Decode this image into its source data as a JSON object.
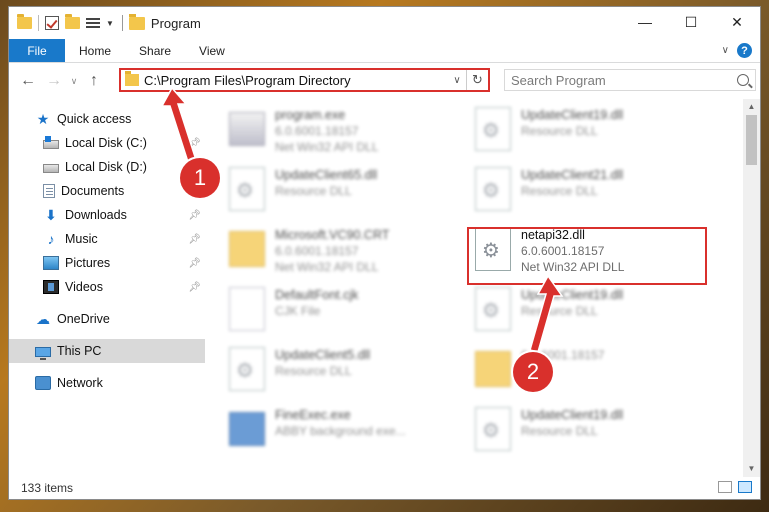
{
  "title_bar": {
    "title": "Program",
    "minimize": "—",
    "maximize": "☐",
    "close": "✕"
  },
  "ribbon": {
    "tabs": [
      "File",
      "Home",
      "Share",
      "View"
    ],
    "help": "?"
  },
  "address_bar": {
    "path": "C:\\Program Files\\Program Directory",
    "search_placeholder": "Search Program"
  },
  "sidebar": {
    "quick_access": "Quick access",
    "items": [
      {
        "label": "Local Disk (C:)",
        "icon": "drive-windows-icon",
        "pinned": true
      },
      {
        "label": "Local Disk (D:)",
        "icon": "drive-icon",
        "pinned": false
      },
      {
        "label": "Documents",
        "icon": "documents-icon",
        "pinned": true
      },
      {
        "label": "Downloads",
        "icon": "download-icon",
        "pinned": true
      },
      {
        "label": "Music",
        "icon": "music-icon",
        "pinned": true
      },
      {
        "label": "Pictures",
        "icon": "pictures-icon",
        "pinned": true
      },
      {
        "label": "Videos",
        "icon": "videos-icon",
        "pinned": true
      }
    ],
    "onedrive": "OneDrive",
    "this_pc": "This PC",
    "network": "Network"
  },
  "files": [
    {
      "name": "program.exe",
      "line1": "6.0.6001.18157",
      "line2": "Net Win32 API DLL",
      "icon": "exe"
    },
    {
      "name": "UpdateClient19.dll",
      "line1": "Resource DLL",
      "line2": "",
      "icon": "doc"
    },
    {
      "name": "UpdateClient65.dll",
      "line1": "Resource DLL",
      "line2": "",
      "icon": "doc"
    },
    {
      "name": "UpdateClient21.dll",
      "line1": "Resource DLL",
      "line2": "",
      "icon": "doc"
    },
    {
      "name": "Microsoft.VC90.CRT",
      "line1": "6.0.6001.18157",
      "line2": "Net Win32 API DLL",
      "icon": "folder"
    },
    {
      "name": "netapi32.dll",
      "line1": "6.0.6001.18157",
      "line2": "Net Win32 API DLL",
      "icon": "doc",
      "focus": true
    },
    {
      "name": "DefaultFont.cjk",
      "line1": "CJK File",
      "line2": "",
      "icon": "plain"
    },
    {
      "name": "UpdateClient19.dll",
      "line1": "Resource DLL",
      "line2": "",
      "icon": "doc"
    },
    {
      "name": "UpdateClient5.dll",
      "line1": "Resource DLL",
      "line2": "",
      "icon": "doc"
    },
    {
      "name": "",
      "line1": "6.0.6001.18157",
      "line2": "",
      "icon": "folder"
    },
    {
      "name": "FineExec.exe",
      "line1": "ABBY background exe...",
      "line2": "",
      "icon": "app"
    },
    {
      "name": "UpdateClient19.dll",
      "line1": "Resource DLL",
      "line2": "",
      "icon": "doc"
    }
  ],
  "status": {
    "item_count": "133 items"
  },
  "callouts": [
    "1",
    "2"
  ],
  "colors": {
    "accent": "#1979ca",
    "highlight": "#d9302c",
    "selection": "#cde8ff"
  }
}
